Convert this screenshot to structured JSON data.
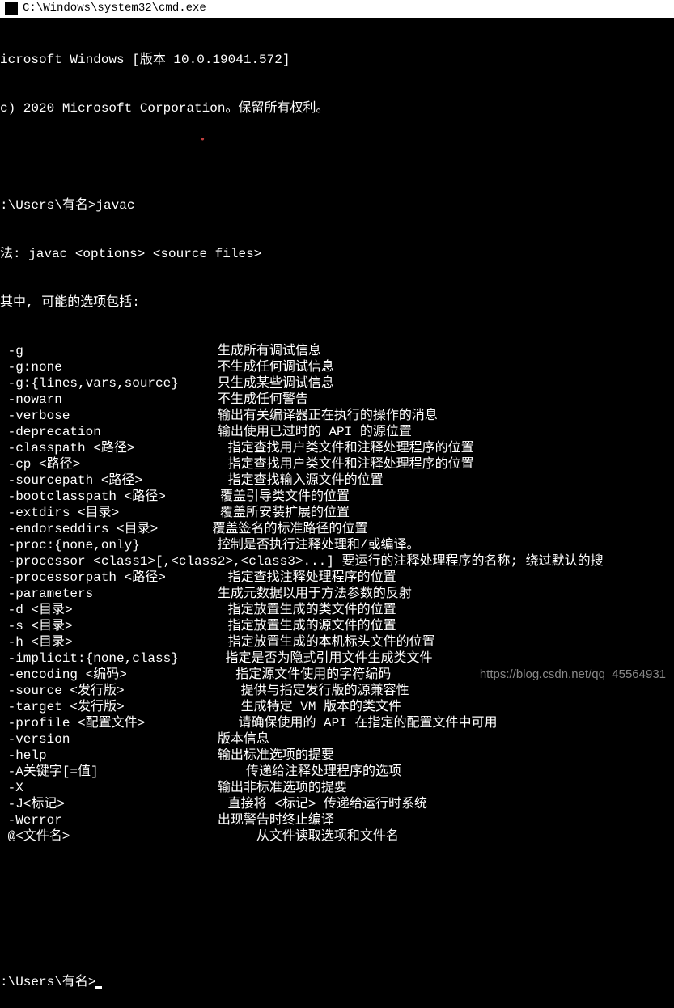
{
  "title_bar": {
    "path": "C:\\Windows\\system32\\cmd.exe"
  },
  "terminal": {
    "header1": "icrosoft Windows [版本 10.0.19041.572]",
    "header2": "c) 2020 Microsoft Corporation。保留所有权利。",
    "blank": "",
    "prompt1": ":\\Users\\有名>javac",
    "usage": "法: javac <options> <source files>",
    "options_intro": "其中, 可能的选项包括:",
    "options": [
      {
        "flag": " -g",
        "desc": "生成所有调试信息"
      },
      {
        "flag": " -g:none",
        "desc": "不生成任何调试信息"
      },
      {
        "flag": " -g:{lines,vars,source}",
        "desc": "只生成某些调试信息"
      },
      {
        "flag": " -nowarn",
        "desc": "不生成任何警告"
      },
      {
        "flag": " -verbose",
        "desc": "输出有关编译器正在执行的操作的消息"
      },
      {
        "flag": " -deprecation",
        "desc": "输出使用已过时的 API 的源位置"
      },
      {
        "flag": " -classpath <路径>",
        "desc": "  指定查找用户类文件和注释处理程序的位置"
      },
      {
        "flag": " -cp <路径>",
        "desc": "  指定查找用户类文件和注释处理程序的位置"
      },
      {
        "flag": " -sourcepath <路径>",
        "desc": "  指定查找输入源文件的位置"
      },
      {
        "flag": " -bootclasspath <路径>",
        "desc": " 覆盖引导类文件的位置"
      },
      {
        "flag": " -extdirs <目录>",
        "desc": " 覆盖所安装扩展的位置"
      },
      {
        "flag": " -endorseddirs <目录>",
        "desc": "覆盖签名的标准路径的位置"
      },
      {
        "flag": " -proc:{none,only}",
        "desc": "控制是否执行注释处理和/或编译。"
      },
      {
        "flag": " -processor <class1>[,<class2>,<class3>...] 要运行的注释处理程序的名称; 绕过默认的搜",
        "desc": ""
      },
      {
        "flag": " -processorpath <路径>",
        "desc": "  指定查找注释处理程序的位置"
      },
      {
        "flag": " -parameters",
        "desc": "生成元数据以用于方法参数的反射"
      },
      {
        "flag": " -d <目录>",
        "desc": "  指定放置生成的类文件的位置"
      },
      {
        "flag": " -s <目录>",
        "desc": "  指定放置生成的源文件的位置"
      },
      {
        "flag": " -h <目录>",
        "desc": "  指定放置生成的本机标头文件的位置"
      },
      {
        "flag": " -implicit:{none,class}",
        "desc": " 指定是否为隐式引用文件生成类文件"
      },
      {
        "flag": " -encoding <编码>",
        "desc": "   指定源文件使用的字符编码"
      },
      {
        "flag": " -source <发行版>",
        "desc": "    提供与指定发行版的源兼容性"
      },
      {
        "flag": " -target <发行版>",
        "desc": "    生成特定 VM 版本的类文件"
      },
      {
        "flag": " -profile <配置文件>",
        "desc": "    请确保使用的 API 在指定的配置文件中可用"
      },
      {
        "flag": " -version",
        "desc": "版本信息"
      },
      {
        "flag": " -help",
        "desc": "输出标准选项的提要"
      },
      {
        "flag": " -A关键字[=值]",
        "desc": "     传递给注释处理程序的选项"
      },
      {
        "flag": " -X",
        "desc": "输出非标准选项的提要"
      },
      {
        "flag": " -J<标记>",
        "desc": "  直接将 <标记> 传递给运行时系统"
      },
      {
        "flag": " -Werror",
        "desc": "出现警告时终止编译"
      },
      {
        "flag": " @<文件名>",
        "desc": "      从文件读取选项和文件名"
      }
    ],
    "prompt2": ":\\Users\\有名>"
  },
  "watermark": "https://blog.csdn.net/qq_45564931"
}
